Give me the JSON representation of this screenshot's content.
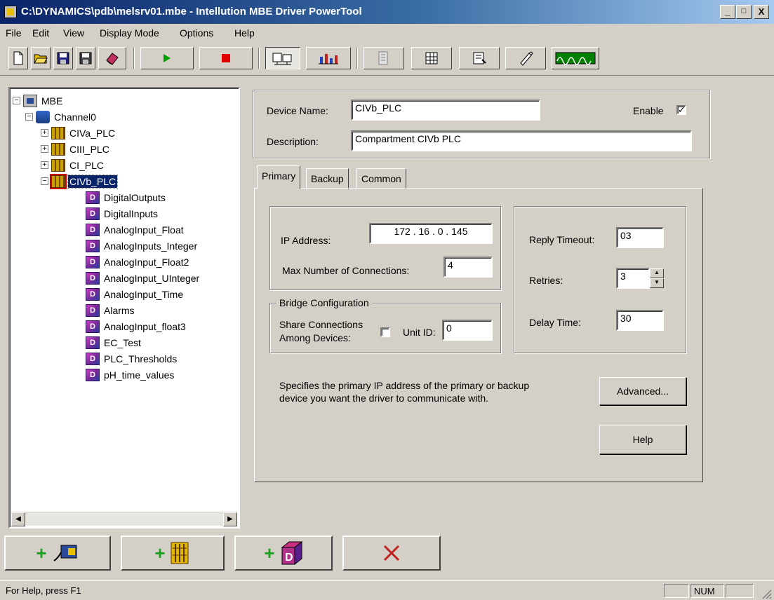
{
  "window": {
    "title": "C:\\DYNAMICS\\pdb\\melsrv01.mbe - Intellution MBE Driver PowerTool",
    "minimize": "_",
    "maximize": "□",
    "close": "X"
  },
  "menu": [
    "File",
    "Edit",
    "View",
    "Display Mode",
    "Options",
    "Help"
  ],
  "toolbar": {
    "buttons": [
      "new-file-icon",
      "open-folder-icon",
      "save-icon",
      "save-as-icon",
      "erase-icon",
      "start-icon",
      "stop-icon",
      "config-view-icon",
      "statistics-icon",
      "properties-icon",
      "network-icon",
      "settings-icon",
      "test-icon",
      "monitor-icon"
    ],
    "colors": {
      "start": "#00a000",
      "stop": "#e00000",
      "monitor": "#008000"
    }
  },
  "tree": {
    "root": "MBE",
    "channel": "Channel0",
    "devices": [
      "CIVa_PLC",
      "CIII_PLC",
      "CI_PLC",
      "CIVb_PLC"
    ],
    "selected_device": "CIVb_PLC",
    "blocks": [
      "DigitalOutputs",
      "DigitalInputs",
      "AnalogInput_Float",
      "AnalogInputs_Integer",
      "AnalogInput_Float2",
      "AnalogInput_UInteger",
      "AnalogInput_Time",
      "Alarms",
      "AnalogInput_float3",
      "EC_Test",
      "PLC_Thresholds",
      "pH_time_values"
    ],
    "block_icon_text": "D"
  },
  "device": {
    "name_label": "Device Name:",
    "name_value": "CIVb_PLC",
    "enable_label": "Enable",
    "enable_checked": "✓",
    "description_label": "Description:",
    "description_value": "Compartment CIVb PLC"
  },
  "tabs": [
    "Primary",
    "Backup",
    "Common"
  ],
  "primary": {
    "ip_label": "IP Address:",
    "ip_value": "172 . 16 . 0 . 145",
    "max_conn_label": "Max Number of Connections:",
    "max_conn_value": "4",
    "bridge_title": "Bridge Configuration",
    "share_label_1": "Share Connections",
    "share_label_2": "Among Devices:",
    "unit_id_label": "Unit ID:",
    "unit_id_value": "0",
    "reply_timeout_label": "Reply Timeout:",
    "reply_timeout_value": "03",
    "retries_label": "Retries:",
    "retries_value": "3",
    "delay_label": "Delay Time:",
    "delay_value": "30",
    "hint_line_1": "Specifies the primary IP address of the primary or backup",
    "hint_line_2": "device you want the driver to communicate with.",
    "advanced_button": "Advanced...",
    "help_button": "Help"
  },
  "bottom_buttons": [
    "add-channel-icon",
    "add-device-icon",
    "add-data-block-icon",
    "delete-icon"
  ],
  "status": {
    "help_text": "For Help, press F1",
    "num": "NUM"
  }
}
